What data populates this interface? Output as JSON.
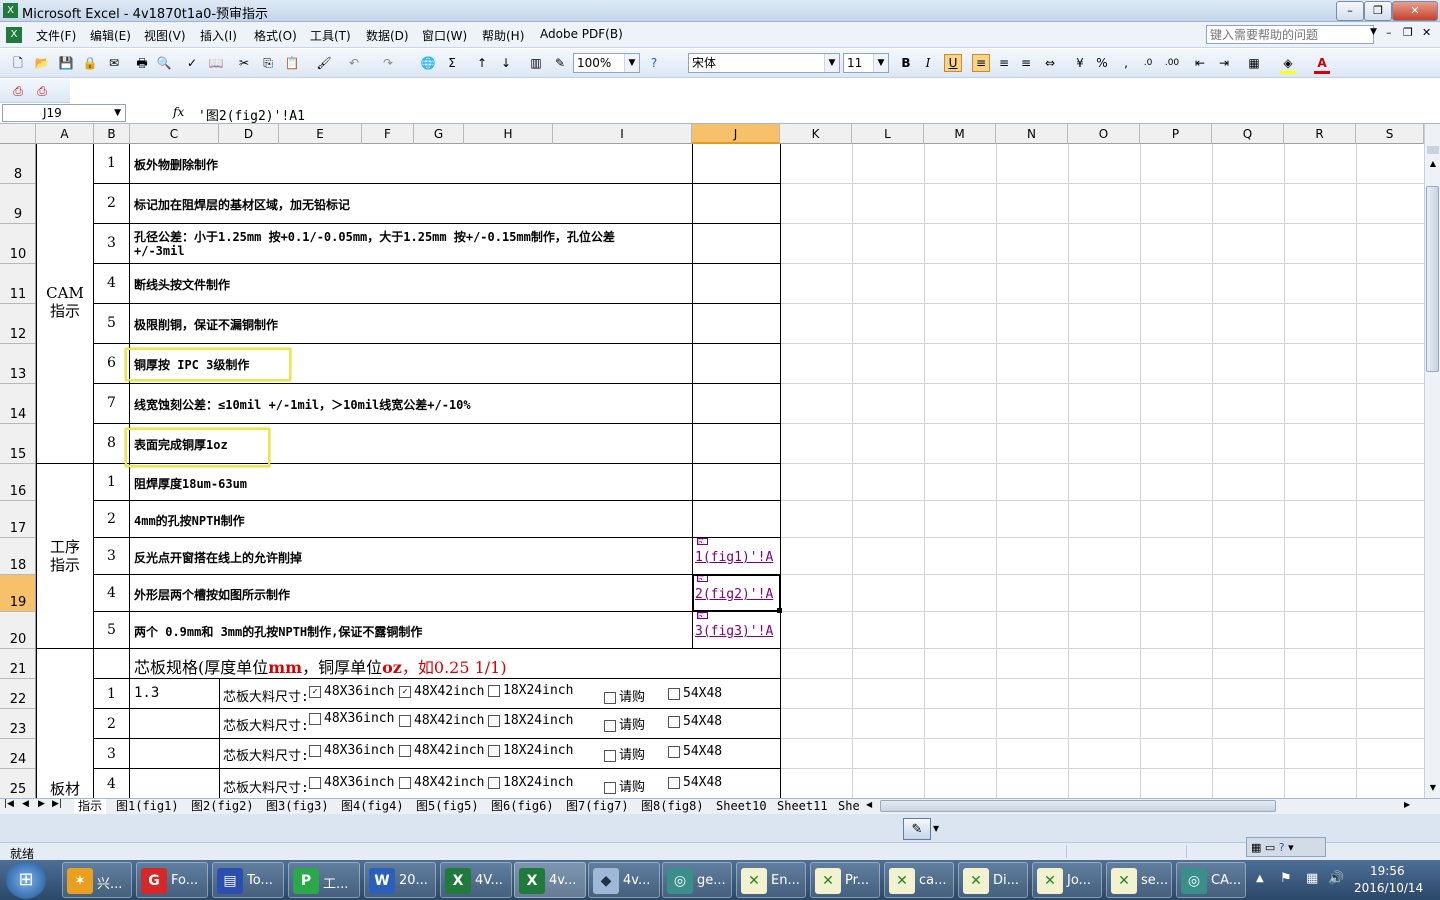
{
  "window": {
    "title": "Microsoft Excel - 4v1870t1a0-预审指示",
    "help_placeholder": "键入需要帮助的问题"
  },
  "menu": [
    "文件(F)",
    "编辑(E)",
    "视图(V)",
    "插入(I)",
    "格式(O)",
    "工具(T)",
    "数据(D)",
    "窗口(W)",
    "帮助(H)",
    "Adobe PDF(B)"
  ],
  "toolbar": {
    "zoom": "100%",
    "font": "宋体",
    "size": "11"
  },
  "formula": {
    "namebox": "J19",
    "fx": "fx",
    "content": "'图2(fig2)'!A1"
  },
  "columns": [
    "A",
    "B",
    "C",
    "D",
    "E",
    "F",
    "G",
    "H",
    "I",
    "J",
    "K",
    "L",
    "M",
    "N",
    "O",
    "P",
    "Q",
    "R",
    "S"
  ],
  "rows": [
    "8",
    "9",
    "10",
    "11",
    "12",
    "13",
    "14",
    "15",
    "16",
    "17",
    "18",
    "19",
    "20",
    "21",
    "22",
    "23",
    "24",
    "25"
  ],
  "cam": {
    "label": "CAM\n指示",
    "items": [
      {
        "n": "1",
        "text": "板外物删除制作"
      },
      {
        "n": "2",
        "text": "标记加在阻焊层的基材区域，加无铅标记"
      },
      {
        "n": "3",
        "text": "孔径公差：小于1.25mm 按+0.1/-0.05mm，大于1.25mm 按+/-0.15mm制作，孔位公差",
        "text2": "+/-3mil"
      },
      {
        "n": "4",
        "text": "断线头按文件制作"
      },
      {
        "n": "5",
        "text": "极限削铜，保证不漏铜制作"
      },
      {
        "n": "6",
        "text": "铜厚按 IPC 3级制作"
      },
      {
        "n": "7",
        "text": "线宽蚀刻公差：≤10mil +/-1mil，＞10mil线宽公差+/-10%"
      },
      {
        "n": "8",
        "text": "表面完成铜厚1oz"
      }
    ]
  },
  "process": {
    "label": "工序\n指示",
    "items": [
      {
        "n": "1",
        "text": "阻焊厚度18um-63um",
        "link": ""
      },
      {
        "n": "2",
        "text": "4mm的孔按NPTH制作",
        "link": ""
      },
      {
        "n": "3",
        "text": "反光点开窗搭在线上的允许削掉",
        "link": "1(fig1)'!A"
      },
      {
        "n": "4",
        "text": "外形层两个槽按如图所示制作",
        "link": "2(fig2)'!A"
      },
      {
        "n": "5",
        "text": "两个 0.9mm和 3mm的孔按NPTH制作,保证不露铜制作",
        "link": "3(fig3)'!A"
      }
    ]
  },
  "board": {
    "label": "板材",
    "heading_pre": "芯板规格(厚度单位",
    "heading_mm": "mm",
    "heading_mid": "，铜厚单位",
    "heading_oz": "oz",
    "heading_post": "，如0.25 1/1)",
    "size_label": "芯板大料尺寸:",
    "options": [
      "48X36inch",
      "48X42inch",
      "18X24inch",
      "请购",
      "54X48"
    ],
    "rows": [
      {
        "n": "1",
        "value": "1.3",
        "checked": [
          true,
          true,
          false,
          false,
          false
        ]
      },
      {
        "n": "2",
        "value": "",
        "checked": [
          false,
          false,
          false,
          false,
          false
        ]
      },
      {
        "n": "3",
        "value": "",
        "checked": [
          false,
          false,
          false,
          false,
          false
        ]
      },
      {
        "n": "4",
        "value": "",
        "checked": [
          false,
          false,
          false,
          false,
          false
        ]
      }
    ]
  },
  "sheets": [
    "指示",
    "图1(fig1)",
    "图2(fig2)",
    "图3(fig3)",
    "图4(fig4)",
    "图5(fig5)",
    "图6(fig6)",
    "图7(fig7)",
    "图8(fig8)",
    "Sheet10",
    "Sheet11",
    "She"
  ],
  "status": "就绪",
  "taskbar": {
    "items": [
      "兴...",
      "Fo...",
      "To...",
      "工...",
      "20...",
      "4V...",
      "4v...",
      "4v...",
      "ge...",
      "En...",
      "Pr...",
      "ca...",
      "Di...",
      "Jo...",
      "se...",
      "CA..."
    ],
    "time": "19:56",
    "date": "2016/10/14"
  },
  "colors": {
    "accent_red": "#dd0000",
    "link": "#800080",
    "highlight": "#e8e84a",
    "selected_header": "#f7c06a"
  }
}
